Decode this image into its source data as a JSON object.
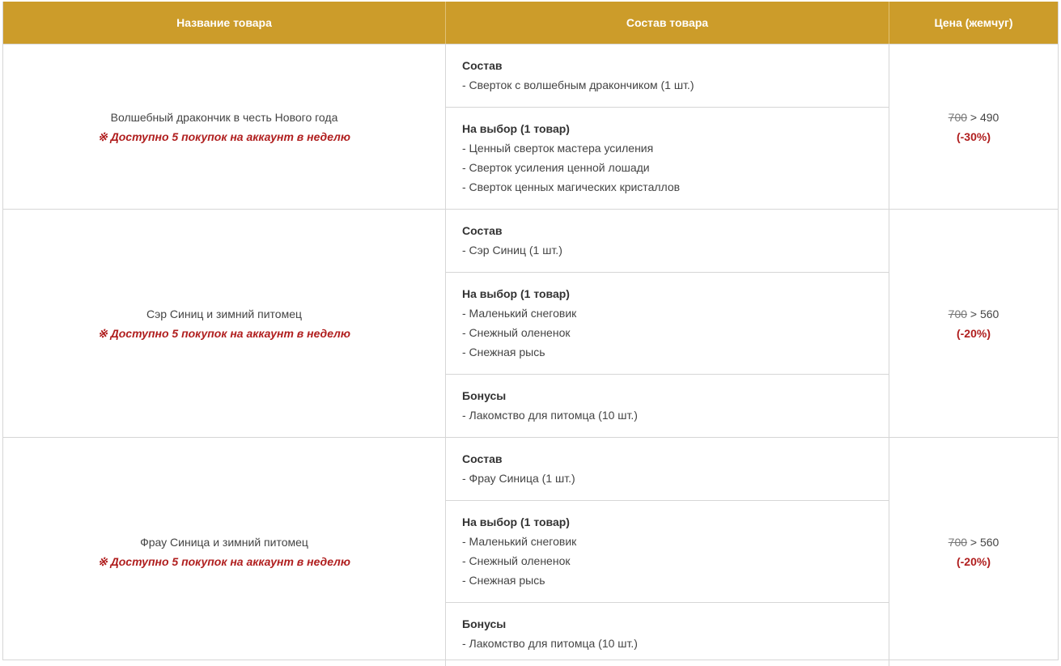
{
  "headers": {
    "name": "Название товара",
    "content": "Состав товара",
    "price": "Цена (жемчуг)"
  },
  "products": [
    {
      "name": "Волшебный дракончик в честь Нового года",
      "limit": "※ Доступно 5 покупок на аккаунт в неделю",
      "old_price": "700",
      "arrow": " > ",
      "new_price": "490",
      "discount": "(-30%)",
      "sections": [
        {
          "title": "Состав",
          "items": [
            "- Сверток с волшебным дракончиком (1 шт.)"
          ]
        },
        {
          "title": "На выбор (1 товар)",
          "items": [
            "- Ценный сверток мастера усиления",
            "- Сверток усиления ценной лошади",
            "- Сверток ценных магических кристаллов"
          ]
        }
      ]
    },
    {
      "name": "Сэр Синиц и зимний питомец",
      "limit": "※ Доступно 5 покупок на аккаунт в неделю",
      "old_price": "700",
      "arrow": " > ",
      "new_price": "560",
      "discount": "(-20%)",
      "sections": [
        {
          "title": "Состав",
          "items": [
            "- Сэр Синиц (1 шт.)"
          ]
        },
        {
          "title": "На выбор (1 товар)",
          "items": [
            "- Маленький снеговик",
            "- Снежный олененок",
            "- Снежная рысь"
          ]
        },
        {
          "title": "Бонусы",
          "items": [
            "- Лакомство для питомца (10 шт.)"
          ]
        }
      ]
    },
    {
      "name": "Фрау Синица и зимний питомец",
      "limit": "※ Доступно 5 покупок на аккаунт в неделю",
      "old_price": "700",
      "arrow": " > ",
      "new_price": "560",
      "discount": "(-20%)",
      "sections": [
        {
          "title": "Состав",
          "items": [
            "- Фрау Синица (1 шт.)"
          ]
        },
        {
          "title": "На выбор (1 товар)",
          "items": [
            "- Маленький снеговик",
            "- Снежный олененок",
            "- Снежная рысь"
          ]
        },
        {
          "title": "Бонусы",
          "items": [
            "- Лакомство для питомца (10 шт.)"
          ]
        }
      ]
    }
  ]
}
